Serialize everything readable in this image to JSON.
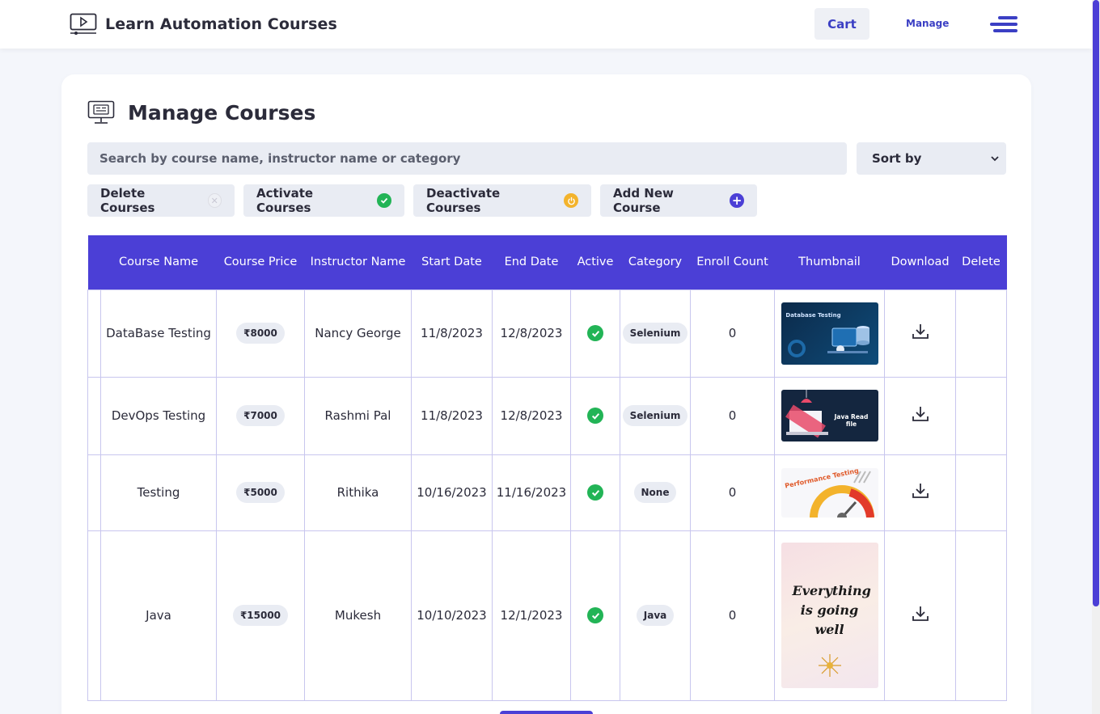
{
  "nav": {
    "brand_title": "Learn Automation Courses",
    "brand_icon": "video-screen-icon",
    "cart_label": "Cart",
    "manage_label": "Manage",
    "menu_icon": "hamburger-menu-icon"
  },
  "page": {
    "title": "Manage Courses",
    "icon": "monitor-courses-icon"
  },
  "search": {
    "placeholder": "Search by course name, instructor name or category"
  },
  "sort": {
    "selected": "Sort by"
  },
  "actions": {
    "delete_label": "Delete Courses",
    "activate_label": "Activate Courses",
    "deactivate_label": "Deactivate Courses",
    "add_label": "Add New Course"
  },
  "table": {
    "headers": [
      "",
      "Course Name",
      "Course Price",
      "Instructor Name",
      "Start Date",
      "End Date",
      "Active",
      "Category",
      "Enroll Count",
      "Thumbnail",
      "Download",
      "Delete"
    ],
    "rows": [
      {
        "name": "DataBase Testing",
        "price": "₹8000",
        "instructor": "Nancy George",
        "start": "11/8/2023",
        "end": "12/8/2023",
        "active": true,
        "category": "Selenium",
        "enroll": "0",
        "thumb_text": "Database Testing"
      },
      {
        "name": "DevOps Testing",
        "price": "₹7000",
        "instructor": "Rashmi Pal",
        "start": "11/8/2023",
        "end": "12/8/2023",
        "active": true,
        "category": "Selenium",
        "enroll": "0",
        "thumb_text": "Java Read file"
      },
      {
        "name": "Testing",
        "price": "₹5000",
        "instructor": "Rithika",
        "start": "10/16/2023",
        "end": "11/16/2023",
        "active": true,
        "category": "None",
        "enroll": "0",
        "thumb_text": "Performance Testing"
      },
      {
        "name": "Java",
        "price": "₹15000",
        "instructor": "Mukesh",
        "start": "10/10/2023",
        "end": "12/1/2023",
        "active": true,
        "category": "Java",
        "enroll": "0",
        "thumb_text": "Everything is going well"
      }
    ]
  },
  "colors": {
    "accent": "#4b3fd6",
    "link": "#3b3fc4",
    "success": "#22b456",
    "warning": "#f3b32c",
    "muted_bg": "#e9ecf3"
  }
}
